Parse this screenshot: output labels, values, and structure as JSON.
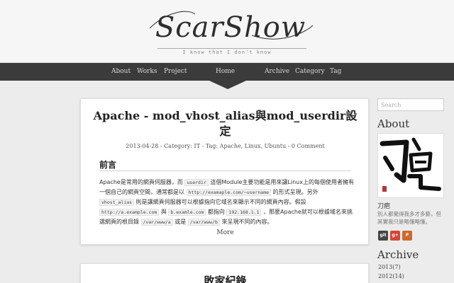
{
  "header": {
    "logo_text": "ScarShow",
    "tagline": "I know that I don't know"
  },
  "nav": {
    "items": [
      {
        "label": "About"
      },
      {
        "label": "Works"
      },
      {
        "label": "Project"
      },
      {
        "label": "Home"
      },
      {
        "label": "Archive"
      },
      {
        "label": "Category"
      },
      {
        "label": "Tag"
      }
    ],
    "active": "Home"
  },
  "post": {
    "title": "Apache - mod_vhost_alias與mod_userdir設定",
    "meta": "2013-04-28  -  Category: IT  -  Tag: Apache, Linux, Ubuntu  -  0 Comment",
    "section_heading": "前言",
    "body": [
      {
        "t": "text",
        "v": "Apache是常用的網頁伺服器，而 "
      },
      {
        "t": "code",
        "v": "userdir"
      },
      {
        "t": "text",
        "v": " 這個Module主要功能是用來讓Linux上的每個使用者擁有一個自己的網頁空間，通常都是以 "
      },
      {
        "t": "code",
        "v": "http://examaple.com/~username"
      },
      {
        "t": "text",
        "v": " 的形式呈現。另外 "
      },
      {
        "t": "code",
        "v": "vhost_alias"
      },
      {
        "t": "text",
        "v": " 則是讓網頁伺服器可以根據指向它域名來顯示不同的網頁內容。假設 "
      },
      {
        "t": "code",
        "v": "http://a.example.com"
      },
      {
        "t": "text",
        "v": " 與 "
      },
      {
        "t": "code",
        "v": "b.examle.com"
      },
      {
        "t": "text",
        "v": " 都指向 "
      },
      {
        "t": "code",
        "v": "192.168.1.1"
      },
      {
        "t": "text",
        "v": " ，那麼Apache就可以根據域名來挑選網頁的根目錄 "
      },
      {
        "t": "code",
        "v": "/var/www/a"
      },
      {
        "t": "text",
        "v": " 或是 "
      },
      {
        "t": "code",
        "v": "/var/www/b"
      },
      {
        "t": "text",
        "v": " 來呈現不同的內容。"
      }
    ],
    "more_label": "More"
  },
  "post2": {
    "title": "敗家紀錄"
  },
  "sidebar": {
    "search_placeholder": "Search",
    "about_heading": "About",
    "author_name": "刀疤",
    "author_desc": "別人都覺得我多才多藝，但其實我只是略懂略懂。",
    "social": [
      {
        "name": "git",
        "label": "git",
        "color": "#444444"
      },
      {
        "name": "google-plus",
        "label": "g+",
        "color": "#d34836"
      },
      {
        "name": "plurk",
        "label": "P",
        "color": "#cf682f"
      }
    ],
    "archive_heading": "Archive",
    "archive": [
      {
        "label": "2013(7)"
      },
      {
        "label": "2012(14)"
      }
    ]
  },
  "colors": {
    "background": "#ececec",
    "nav": "#3b3b3b",
    "card": "#ffffff"
  }
}
